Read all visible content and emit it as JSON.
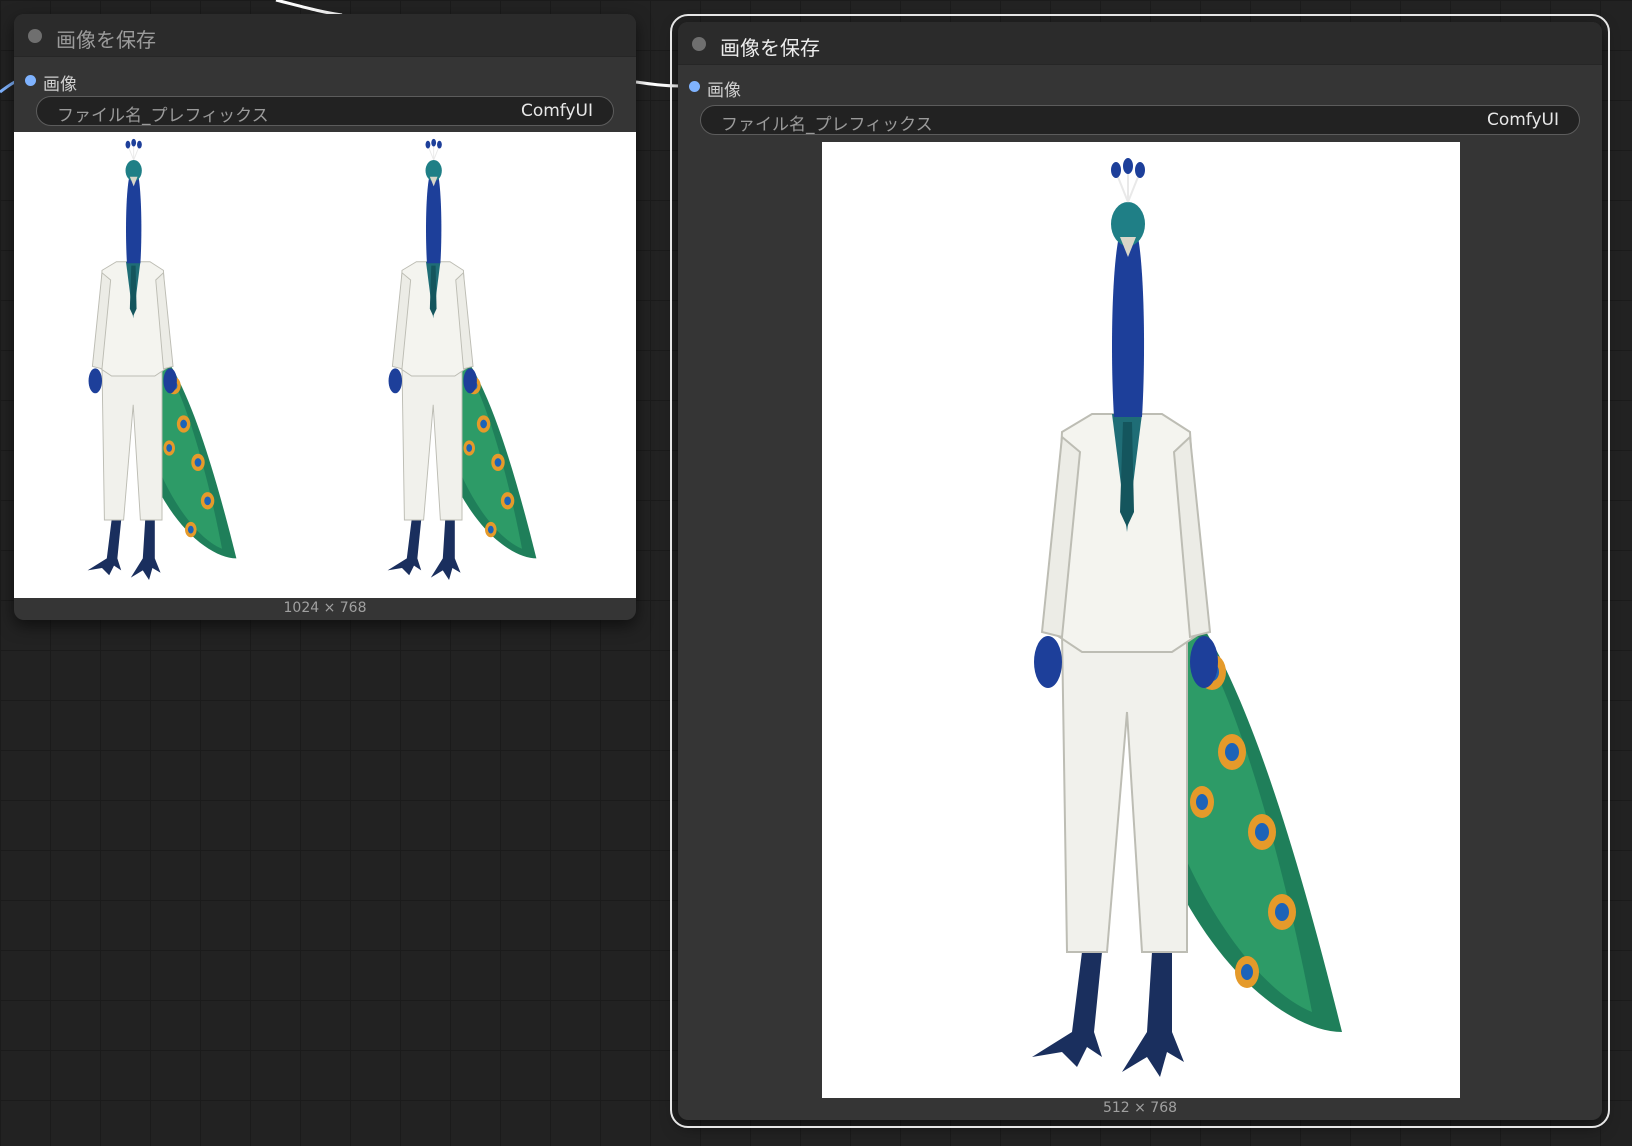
{
  "canvas": {
    "background": "#222222",
    "link_color": "#ffffff",
    "input_dot_color": "#7fb3ff"
  },
  "nodes": [
    {
      "title": "画像を保存",
      "input_label": "画像",
      "widget": {
        "name": "ファイル名_プレフィックス",
        "value": "ComfyUI"
      },
      "preview": {
        "subject": "peacock-headed figure in white suit (two images)",
        "count": 2
      },
      "size_label": "1024 × 768"
    },
    {
      "title": "画像を保存",
      "input_label": "画像",
      "widget": {
        "name": "ファイル名_プレフィックス",
        "value": "ComfyUI"
      },
      "preview": {
        "subject": "peacock-headed figure in white suit",
        "count": 1
      },
      "size_label": "512 × 768",
      "selected": true
    }
  ]
}
